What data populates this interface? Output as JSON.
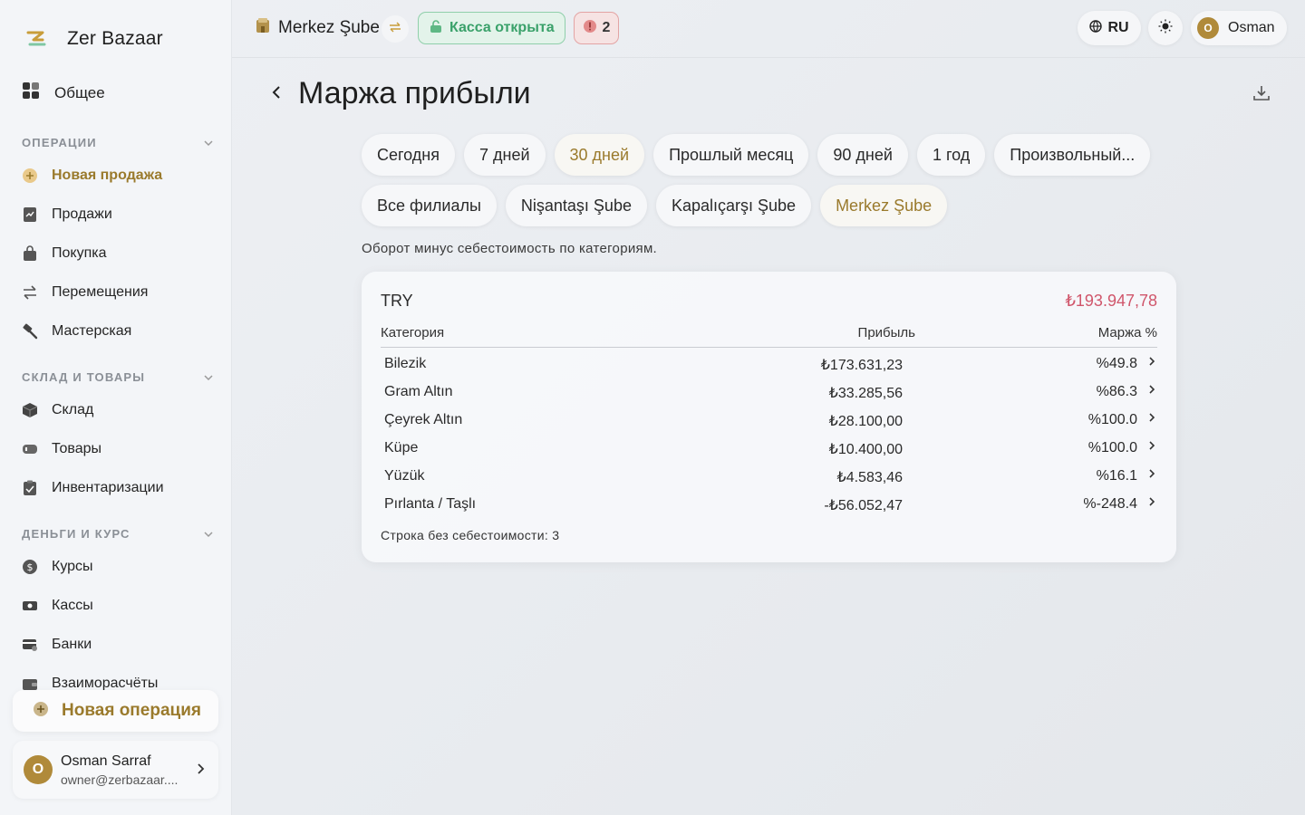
{
  "app": {
    "name": "Zer Bazaar"
  },
  "sidebar": {
    "top_item": {
      "label": "Общее",
      "icon": "dashboard-grid-icon"
    },
    "sections": [
      {
        "title": "ОПЕРАЦИИ",
        "items": [
          {
            "label": "Новая продажа",
            "icon": "add-circle-icon",
            "active": true
          },
          {
            "label": "Продажи",
            "icon": "receipt-icon"
          },
          {
            "label": "Покупка",
            "icon": "shopping-bag-icon"
          },
          {
            "label": "Перемещения",
            "icon": "transfer-arrows-icon"
          },
          {
            "label": "Мастерская",
            "icon": "hammer-icon"
          }
        ]
      },
      {
        "title": "СКЛАД И ТОВАРЫ",
        "items": [
          {
            "label": "Склад",
            "icon": "box-icon"
          },
          {
            "label": "Товары",
            "icon": "tag-icon"
          },
          {
            "label": "Инвентаризации",
            "icon": "clipboard-check-icon"
          }
        ]
      },
      {
        "title": "ДЕНЬГИ И КУРС",
        "items": [
          {
            "label": "Курсы",
            "icon": "dollar-coin-icon"
          },
          {
            "label": "Кассы",
            "icon": "cash-icon"
          },
          {
            "label": "Банки",
            "icon": "bank-card-icon"
          },
          {
            "label": "Взаиморасчёты",
            "icon": "wallet-icon"
          }
        ]
      }
    ],
    "new_operation": "Новая операция",
    "user": {
      "initial": "O",
      "name": "Osman Sarraf",
      "email": "owner@zerbazaar...."
    }
  },
  "topbar": {
    "branch": "Merkez Şube",
    "cash_status": "Касса открыта",
    "alerts_count": "2",
    "language": "RU",
    "user": {
      "initial": "O",
      "name": "Osman"
    }
  },
  "page": {
    "title": "Маржа прибыли",
    "periods": [
      "Сегодня",
      "7 дней",
      "30 дней",
      "Прошлый месяц",
      "90 дней",
      "1 год",
      "Произвольный..."
    ],
    "active_period": "30 дней",
    "branches": [
      "Все филиалы",
      "Nişantaşı Şube",
      "Kapalıçarşı Şube",
      "Merkez Şube"
    ],
    "active_branch": "Merkez Şube",
    "subtitle": "Оборот минус себестоимость по категориям.",
    "card": {
      "currency": "TRY",
      "total": "₺193.947,78",
      "columns": {
        "category": "Категория",
        "profit": "Прибыль",
        "margin": "Маржа %"
      },
      "rows": [
        {
          "category": "Bilezik",
          "profit": "₺173.631,23",
          "margin": "%49.8"
        },
        {
          "category": "Gram Altın",
          "profit": "₺33.285,56",
          "margin": "%86.3"
        },
        {
          "category": "Çeyrek Altın",
          "profit": "₺28.100,00",
          "margin": "%100.0"
        },
        {
          "category": "Küpe",
          "profit": "₺10.400,00",
          "margin": "%100.0"
        },
        {
          "category": "Yüzük",
          "profit": "₺4.583,46",
          "margin": "%16.1"
        },
        {
          "category": "Pırlanta / Taşlı",
          "profit": "-₺56.052,47",
          "margin": "%-248.4"
        }
      ],
      "footer": "Строка без себестоимости: 3"
    }
  },
  "colors": {
    "accent_gold": "#9a7a2c",
    "total_red": "#d0566b",
    "cash_green": "#3aa16a"
  }
}
